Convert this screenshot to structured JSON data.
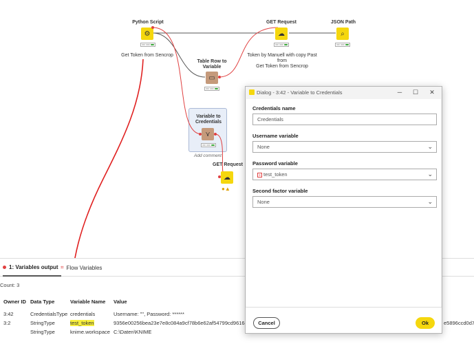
{
  "workflow": {
    "nodes": {
      "python_script": {
        "title": "Python Script",
        "note": "Get Token from Sencrop"
      },
      "get_request_1": {
        "title": "GET Request",
        "note_lines": [
          "Token by Manuell with copy Past",
          "from",
          "Get Token from Sencrop"
        ]
      },
      "json_path": {
        "title": "JSON Path"
      },
      "table_row_to_variable": {
        "title_lines": [
          "Table Row to",
          "Variable"
        ]
      },
      "variable_to_credentials": {
        "title_lines": [
          "Variable to",
          "Credentials"
        ],
        "note": "Add comment"
      },
      "get_request_2": {
        "title": "GET Request"
      }
    },
    "colors": {
      "connection": "#555555",
      "variable_connection": "#e04040",
      "annotation_arrow": "#e02020",
      "node_yellow": "#f5d70e",
      "node_brown": "#c59a7b"
    }
  },
  "panel": {
    "tabs": [
      {
        "label": "1: Variables output",
        "icon": "red-dot-icon"
      },
      {
        "label": "Flow Variables",
        "icon": "flow-variables-icon"
      }
    ],
    "count_label": "Count: 3",
    "columns": [
      "Owner ID",
      "Data Type",
      "Variable Name",
      "Value"
    ],
    "rows": [
      {
        "owner": "3:42",
        "type": "CredentialsType",
        "name": "credentials",
        "value": "Username: \"\", Password: ******"
      },
      {
        "owner": "3:2",
        "type": "StringType",
        "name": "test_token",
        "value": "9356e00256bea23e7e8c084a9cf78b6e62af54799cd96164",
        "value_tail": "e5896ccd0d7"
      },
      {
        "owner": "",
        "type": "StringType",
        "name": "knime.workspace",
        "value": "C:\\Daten\\KNIME"
      }
    ]
  },
  "dialog": {
    "title": "Dialog - 3:42 - Variable to Credentials",
    "fields": {
      "credentials_name": {
        "label": "Credentials name",
        "value": "Credentials"
      },
      "username_variable": {
        "label": "Username variable",
        "value": "None"
      },
      "password_variable": {
        "label": "Password variable",
        "value": "test_token",
        "icon": "string-variable-icon"
      },
      "second_factor_variable": {
        "label": "Second factor variable",
        "value": "None"
      }
    },
    "buttons": {
      "cancel": "Cancel",
      "ok": "Ok"
    }
  }
}
